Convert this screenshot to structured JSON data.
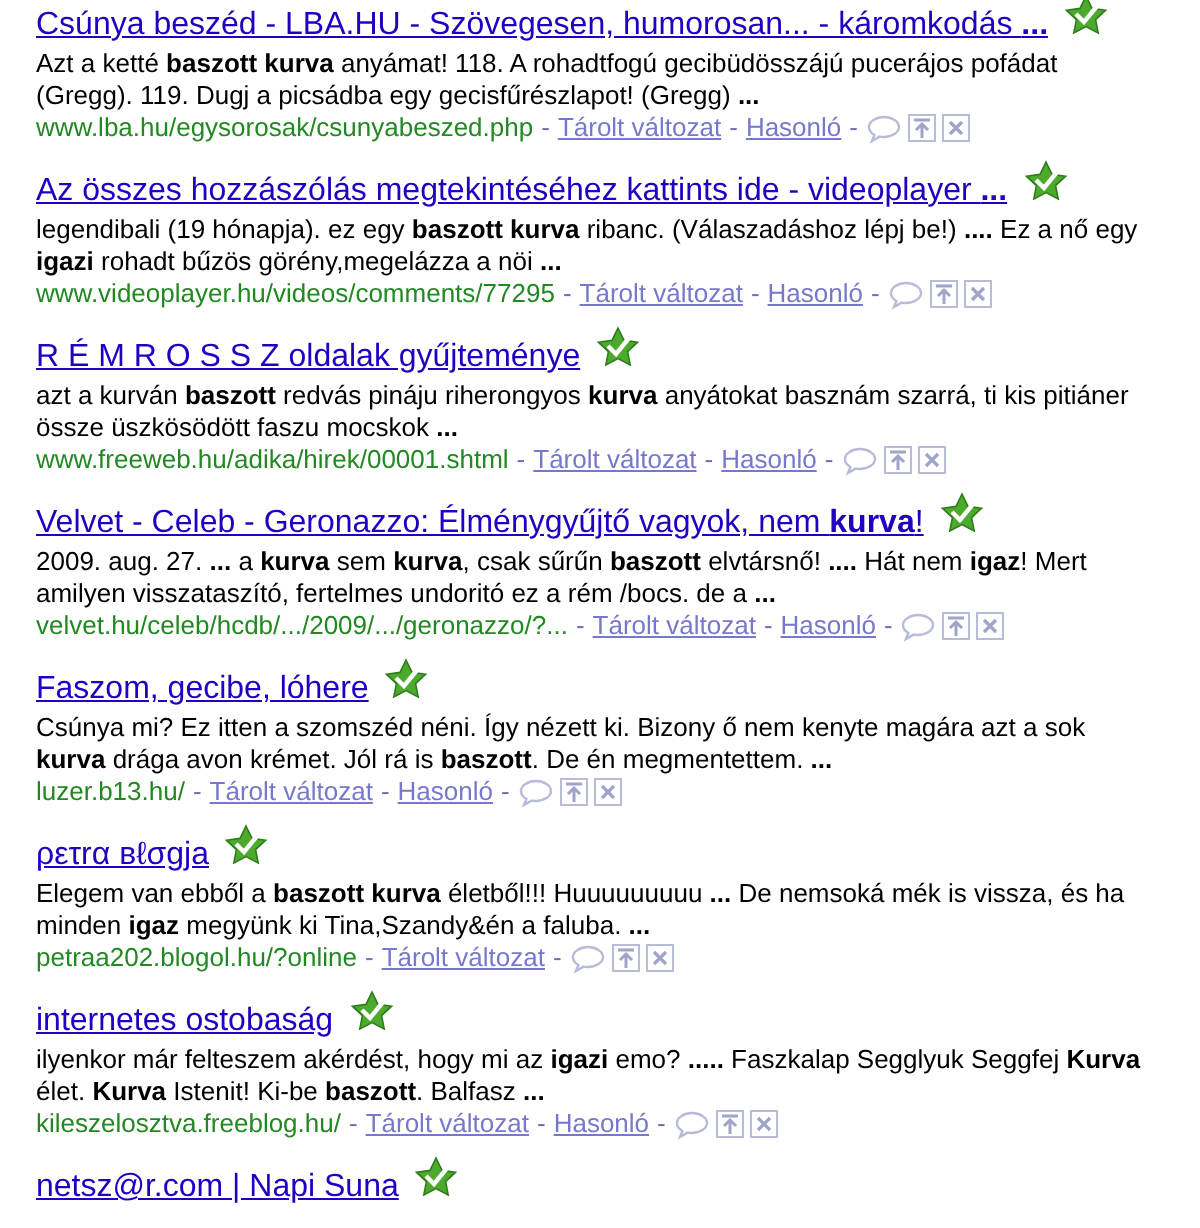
{
  "results": [
    {
      "title": "Csúnya beszéd - LBA.HU - Szövegesen, humorosan... - káromkodás **...**",
      "snippet": "Azt a ketté **baszott kurva** anyámat! 118. A rohadtfogú gecibüdösszájú pucerájos pofádat (Gregg). 119. Dugj a picsádba egy gecisfűrészlapot! (Gregg) **...**",
      "footer": [
        {
          "kind": "url",
          "text": "www.lba.hu/egysorosak/csunyabeszed.php"
        },
        {
          "kind": "sep",
          "text": "-"
        },
        {
          "kind": "link",
          "text": "Tárolt változat"
        },
        {
          "kind": "sep",
          "text": "-"
        },
        {
          "kind": "link",
          "text": "Hasonló"
        },
        {
          "kind": "sep",
          "text": "-"
        },
        {
          "kind": "comment"
        },
        {
          "kind": "promote"
        },
        {
          "kind": "remove"
        }
      ]
    },
    {
      "title": "Az összes hozzászólás megtekintéséhez kattints ide - videoplayer **...**",
      "snippet": "legendibali (19 hónapja). ez egy **baszott kurva** ribanc. (Válaszadáshoz lépj be!) **....** Ez a nő egy **igazi** rohadt bűzös görény,megelázza a nöi **...**",
      "footer": [
        {
          "kind": "url",
          "text": "www.videoplayer.hu/videos/comments/77295"
        },
        {
          "kind": "sep",
          "text": "-"
        },
        {
          "kind": "link",
          "text": "Tárolt változat"
        },
        {
          "kind": "sep",
          "text": "-"
        },
        {
          "kind": "link",
          "text": "Hasonló"
        },
        {
          "kind": "sep",
          "text": "-"
        },
        {
          "kind": "comment"
        },
        {
          "kind": "promote"
        },
        {
          "kind": "remove"
        }
      ]
    },
    {
      "title": "R É M R O S S Z oldalak gyűjteménye",
      "snippet": "azt a kurván **baszott** redvás pináju riherongyos **kurva** anyátokat basznám szarrá, ti kis pitiáner össze üszkösödött faszu mocskok **...**",
      "footer": [
        {
          "kind": "url",
          "text": "www.freeweb.hu/adika/hirek/00001.shtml"
        },
        {
          "kind": "sep",
          "text": "-"
        },
        {
          "kind": "link",
          "text": "Tárolt változat"
        },
        {
          "kind": "sep",
          "text": "-"
        },
        {
          "kind": "link",
          "text": "Hasonló"
        },
        {
          "kind": "sep",
          "text": "-"
        },
        {
          "kind": "comment"
        },
        {
          "kind": "promote"
        },
        {
          "kind": "remove"
        }
      ]
    },
    {
      "title": "Velvet - Celeb - Geronazzo: Élménygyűjtő vagyok, nem **kurva**!",
      "snippet": "2009. aug. 27. **...** a **kurva** sem **kurva**, csak sűrűn **baszott** elvtársnő! **....** Hát nem **igaz**! Mert amilyen visszataszító, fertelmes undoritó ez a rém /bocs. de a **...**",
      "footer": [
        {
          "kind": "url",
          "text": "velvet.hu/celeb/hcdb/.../2009/.../geronazzo/?..."
        },
        {
          "kind": "sep",
          "text": "-"
        },
        {
          "kind": "link",
          "text": "Tárolt változat"
        },
        {
          "kind": "sep",
          "text": "-"
        },
        {
          "kind": "link",
          "text": "Hasonló"
        },
        {
          "kind": "sep",
          "text": "-"
        },
        {
          "kind": "comment"
        },
        {
          "kind": "promote"
        },
        {
          "kind": "remove"
        }
      ]
    },
    {
      "title": "Faszom, gecibe, lóhere",
      "snippet": "Csúnya mi? Ez itten a szomszéd néni. Így nézett ki. Bizony ő nem kenyte magára azt a sok **kurva** drága avon krémet. Jól rá is **baszott**. De én megmentettem. **...**",
      "footer": [
        {
          "kind": "url",
          "text": "luzer.b13.hu/"
        },
        {
          "kind": "sep",
          "text": "-"
        },
        {
          "kind": "link",
          "text": "Tárolt változat"
        },
        {
          "kind": "sep",
          "text": "-"
        },
        {
          "kind": "link",
          "text": "Hasonló"
        },
        {
          "kind": "sep",
          "text": "-"
        },
        {
          "kind": "comment"
        },
        {
          "kind": "promote"
        },
        {
          "kind": "remove"
        }
      ]
    },
    {
      "title": "ρετrα вℓσgja",
      "snippet": "Elegem van ebből a **baszott kurva** életből!!! Huuuuuuuuu **...** De nemsoká mék is vissza, és ha minden **igaz** megyünk ki Tina,Szandy&én a faluba. **...**",
      "footer": [
        {
          "kind": "url",
          "text": "petraa202.blogol.hu/?online"
        },
        {
          "kind": "sep",
          "text": "-"
        },
        {
          "kind": "link",
          "text": "Tárolt változat"
        },
        {
          "kind": "sep",
          "text": "-"
        },
        {
          "kind": "comment"
        },
        {
          "kind": "promote"
        },
        {
          "kind": "remove"
        }
      ]
    },
    {
      "title": "internetes ostobaság",
      "snippet": "ilyenkor már felteszem akérdést, hogy mi az **igazi** emo? **.....** Faszkalap Segglyuk Seggfej **Kurva** élet. **Kurva** Istenit! Ki-be **baszott**. Balfasz **...**",
      "footer": [
        {
          "kind": "url",
          "text": "kileszelosztva.freeblog.hu/"
        },
        {
          "kind": "sep",
          "text": "-"
        },
        {
          "kind": "link",
          "text": "Tárolt változat"
        },
        {
          "kind": "sep",
          "text": "-"
        },
        {
          "kind": "link",
          "text": "Hasonló"
        },
        {
          "kind": "sep",
          "text": "-"
        },
        {
          "kind": "comment"
        },
        {
          "kind": "promote"
        },
        {
          "kind": "remove"
        }
      ]
    },
    {
      "title": "netsz@r.com | Napi Suna"
    }
  ]
}
